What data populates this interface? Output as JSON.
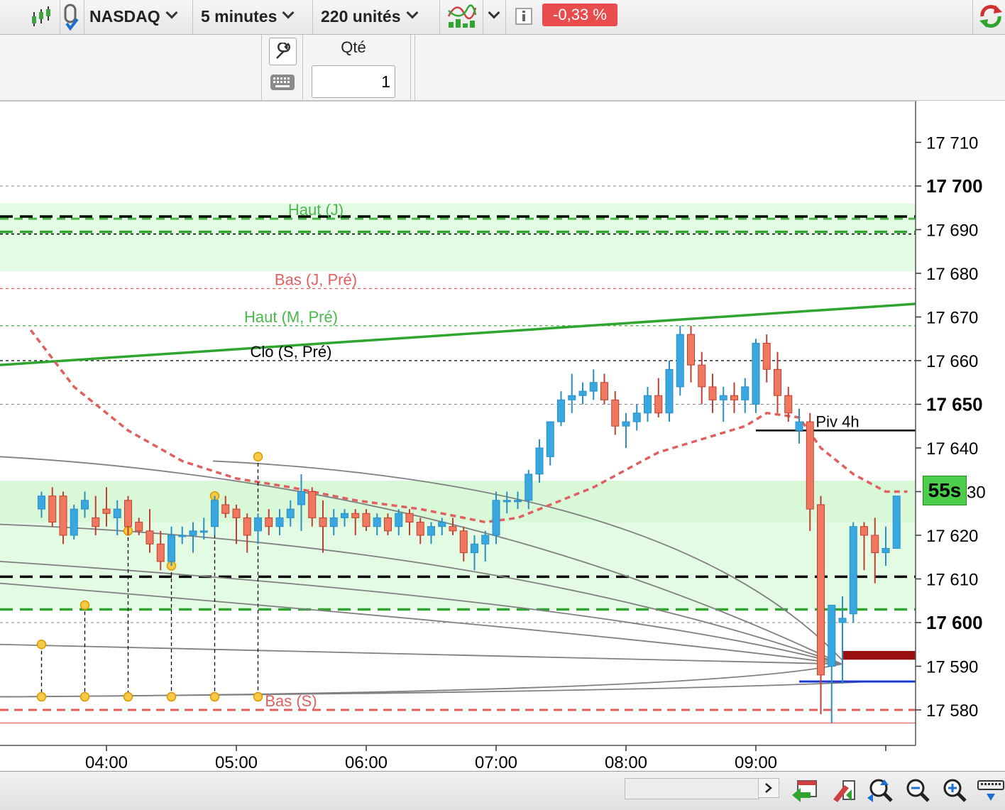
{
  "toolbar": {
    "instrument": "NASDAQ",
    "timeframe": "5 minutes",
    "units": "220 unités",
    "change_pct": "-0,33 %",
    "info_icon": "info-icon",
    "colors": {
      "change_bg": "#e84c4c"
    }
  },
  "order": {
    "qty_label": "Qté",
    "qty_value": "1"
  },
  "countdown": "55s",
  "chart_data": {
    "type": "candlestick",
    "x_tick_labels": [
      "04:00",
      "05:00",
      "06:00",
      "07:00",
      "08:00",
      "09:00"
    ],
    "y_tick_labels": [
      {
        "value": 17710,
        "label": "17 710",
        "bold": false
      },
      {
        "value": 17700,
        "label": "17 700",
        "bold": true
      },
      {
        "value": 17690,
        "label": "17 690",
        "bold": false
      },
      {
        "value": 17680,
        "label": "17 680",
        "bold": false
      },
      {
        "value": 17670,
        "label": "17 670",
        "bold": false
      },
      {
        "value": 17660,
        "label": "17 660",
        "bold": false
      },
      {
        "value": 17650,
        "label": "17 650",
        "bold": true
      },
      {
        "value": 17640,
        "label": "17 640",
        "bold": false
      },
      {
        "value": 17630,
        "label": "30",
        "bold": false
      },
      {
        "value": 17620,
        "label": "17 620",
        "bold": false
      },
      {
        "value": 17610,
        "label": "17 610",
        "bold": false
      },
      {
        "value": 17600,
        "label": "17 600",
        "bold": true
      },
      {
        "value": 17590,
        "label": "17 590",
        "bold": false
      },
      {
        "value": 17580,
        "label": "17 580",
        "bold": false
      }
    ],
    "ylim": [
      17574,
      17716
    ],
    "time_range": [
      "03:25",
      "09:55"
    ],
    "grid": false,
    "colors": {
      "up": "#3aa8e0",
      "down": "#f07860",
      "band": "#e2fbe2",
      "trend": "#2fa52f",
      "ma": "#e06060"
    },
    "levels": [
      {
        "label": "Haut (J)",
        "value": 17692.5,
        "color": "#4cb84c",
        "style": "dash"
      },
      {
        "label": "Bas (J, Pré)",
        "value": 17676.5,
        "color": "#e06060",
        "style": "dot"
      },
      {
        "label": "Haut (M, Pré)",
        "value": 17668,
        "color": "#4cb84c",
        "style": "dot"
      },
      {
        "label": "Clo (S, Pré)",
        "value": 17660,
        "color": "#000000",
        "style": "dot"
      },
      {
        "label": "Piv 4h",
        "value": 17644,
        "color": "#000000",
        "style": "solid"
      },
      {
        "label": "Bas (S)",
        "value": 17580,
        "color": "#e06060",
        "style": "dash"
      }
    ],
    "series": [
      {
        "name": "candles",
        "ohlc": [
          [
            "03:30",
            17626,
            17630,
            17624,
            17629
          ],
          [
            "03:35",
            17629,
            17631,
            17622,
            17623
          ],
          [
            "03:40",
            17629,
            17630,
            17618,
            17620
          ],
          [
            "03:45",
            17620,
            17627,
            17619,
            17626
          ],
          [
            "03:50",
            17626,
            17630,
            17624,
            17628
          ],
          [
            "03:55",
            17624,
            17629,
            17620,
            17622
          ],
          [
            "04:00",
            17626,
            17631,
            17622,
            17625
          ],
          [
            "04:05",
            17624,
            17628,
            17620,
            17626
          ],
          [
            "04:10",
            17628,
            17629,
            17620,
            17622
          ],
          [
            "04:15",
            17623,
            17624,
            17620,
            17621
          ],
          [
            "04:20",
            17621,
            17626,
            17616,
            17618
          ],
          [
            "04:25",
            17618,
            17621,
            17612,
            17614
          ],
          [
            "04:30",
            17614,
            17622,
            17613,
            17620
          ],
          [
            "04:35",
            17620,
            17622,
            17618,
            17620
          ],
          [
            "04:40",
            17620,
            17623,
            17616,
            17621
          ],
          [
            "04:45",
            17621,
            17624,
            17619,
            17621
          ],
          [
            "04:50",
            17622,
            17629,
            17620,
            17628
          ],
          [
            "04:55",
            17627,
            17629,
            17624,
            17625
          ],
          [
            "05:00",
            17626,
            17627,
            17618,
            17624
          ],
          [
            "05:05",
            17624,
            17625,
            17616,
            17620
          ],
          [
            "05:10",
            17621,
            17625,
            17618,
            17624
          ],
          [
            "05:15",
            17624,
            17626,
            17620,
            17622
          ],
          [
            "05:20",
            17622,
            17626,
            17620,
            17624
          ],
          [
            "05:25",
            17624,
            17628,
            17622,
            17626
          ],
          [
            "05:30",
            17627,
            17634,
            17621,
            17630
          ],
          [
            "05:35",
            17630,
            17631,
            17622,
            17624
          ],
          [
            "05:40",
            17624,
            17628,
            17616,
            17622
          ],
          [
            "05:45",
            17622,
            17626,
            17620,
            17624
          ],
          [
            "05:50",
            17624,
            17626,
            17622,
            17625
          ],
          [
            "05:55",
            17625,
            17626,
            17620,
            17624
          ],
          [
            "06:00",
            17625,
            17626,
            17621,
            17622
          ],
          [
            "06:05",
            17622,
            17625,
            17620,
            17624
          ],
          [
            "06:10",
            17624,
            17625,
            17620,
            17621
          ],
          [
            "06:15",
            17622,
            17626,
            17620,
            17625
          ],
          [
            "06:20",
            17625,
            17626,
            17620,
            17623
          ],
          [
            "06:25",
            17623,
            17624,
            17618,
            17620
          ],
          [
            "06:30",
            17620,
            17623,
            17618,
            17622
          ],
          [
            "06:35",
            17622,
            17624,
            17620,
            17623
          ],
          [
            "06:40",
            17622,
            17624,
            17620,
            17621
          ],
          [
            "06:45",
            17621,
            17622,
            17614,
            17616
          ],
          [
            "06:50",
            17616,
            17620,
            17612,
            17618
          ],
          [
            "06:55",
            17618,
            17621,
            17614,
            17620
          ],
          [
            "07:00",
            17620,
            17630,
            17618,
            17628
          ],
          [
            "07:05",
            17628,
            17630,
            17625,
            17628
          ],
          [
            "07:10",
            17628,
            17630,
            17626,
            17628
          ],
          [
            "07:15",
            17628,
            17635,
            17626,
            17634
          ],
          [
            "07:20",
            17634,
            17642,
            17632,
            17640
          ],
          [
            "07:25",
            17638,
            17646,
            17636,
            17646
          ],
          [
            "07:30",
            17646,
            17653,
            17645,
            17651
          ],
          [
            "07:35",
            17651,
            17657,
            17648,
            17652
          ],
          [
            "07:40",
            17652,
            17655,
            17650,
            17653
          ],
          [
            "07:45",
            17653,
            17658,
            17651,
            17655
          ],
          [
            "07:50",
            17655,
            17657,
            17650,
            17651
          ],
          [
            "07:55",
            17651,
            17653,
            17643,
            17645
          ],
          [
            "08:00",
            17645,
            17648,
            17640,
            17646
          ],
          [
            "08:05",
            17646,
            17650,
            17644,
            17648
          ],
          [
            "08:10",
            17648,
            17654,
            17646,
            17652
          ],
          [
            "08:15",
            17652,
            17656,
            17647,
            17648
          ],
          [
            "08:20",
            17648,
            17660,
            17646,
            17658
          ],
          [
            "08:25",
            17654,
            17668,
            17652,
            17666
          ],
          [
            "08:30",
            17666,
            17668,
            17655,
            17659
          ],
          [
            "08:35",
            17659,
            17662,
            17650,
            17654
          ],
          [
            "08:40",
            17654,
            17657,
            17648,
            17651
          ],
          [
            "08:45",
            17651,
            17654,
            17646,
            17652
          ],
          [
            "08:50",
            17652,
            17655,
            17648,
            17651
          ],
          [
            "08:55",
            17651,
            17656,
            17648,
            17654
          ],
          [
            "09:00",
            17650,
            17665,
            17648,
            17664
          ],
          [
            "09:05",
            17664,
            17666,
            17655,
            17658
          ],
          [
            "09:10",
            17658,
            17662,
            17648,
            17652
          ],
          [
            "09:15",
            17652,
            17654,
            17646,
            17648
          ],
          [
            "09:20",
            17644,
            17649,
            17641,
            17646
          ],
          [
            "09:25",
            17646,
            17648,
            17621,
            17626
          ],
          [
            "09:30",
            17627,
            17629,
            17579,
            17588
          ],
          [
            "09:35",
            17590,
            17602,
            17577,
            17604
          ],
          [
            "09:40",
            17600,
            17606,
            17586,
            17601
          ],
          [
            "09:45",
            17602,
            17623,
            17600,
            17622
          ],
          [
            "09:50",
            17622,
            17623,
            17612,
            17620
          ],
          [
            "09:55",
            17620,
            17624,
            17609,
            17616
          ],
          [
            "10:00",
            17616,
            17622,
            17613,
            17617
          ],
          [
            "10:05",
            17617,
            17629,
            17617,
            17629
          ],
          [
            "10:10",
            17629,
            17631,
            17623,
            17630
          ]
        ]
      },
      {
        "name": "moving average",
        "x": [
          "03:25",
          "03:45",
          "04:10",
          "04:35",
          "05:00",
          "05:25",
          "05:55",
          "06:25",
          "06:55",
          "07:10",
          "07:25",
          "07:45",
          "08:00",
          "08:15",
          "08:35",
          "08:55",
          "09:05",
          "09:20",
          "09:30",
          "09:45",
          "10:00",
          "10:10"
        ],
        "values": [
          17667,
          17654,
          17644,
          17637,
          17633,
          17631,
          17628,
          17626,
          17623,
          17624,
          17627,
          17631,
          17635,
          17639,
          17642,
          17645,
          17648,
          17647,
          17640,
          17634,
          17630,
          17630
        ]
      },
      {
        "name": "trend line",
        "x": [
          "03:25",
          "10:10"
        ],
        "values": [
          17659,
          17673
        ]
      }
    ]
  }
}
